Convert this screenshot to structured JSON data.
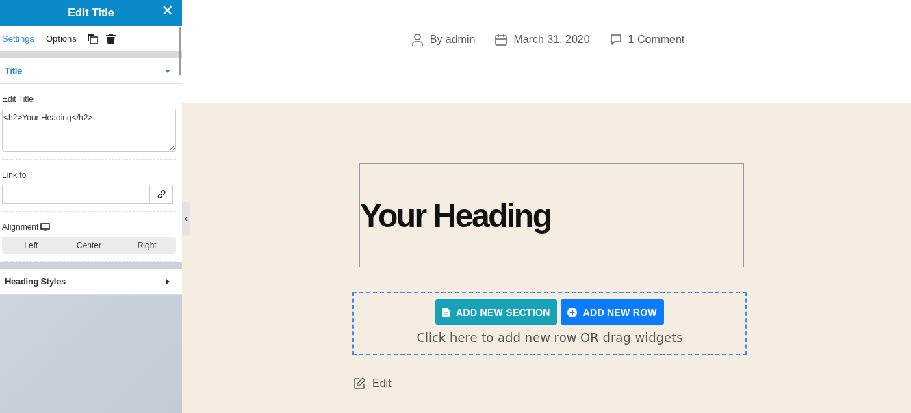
{
  "panel": {
    "title": "Edit Title",
    "close": "✕",
    "tabs": [
      {
        "label": "Settings",
        "selected": true
      },
      {
        "label": "Options",
        "selected": false
      }
    ],
    "sections": [
      {
        "title": "Title",
        "expanded": true
      },
      {
        "title": "Heading Styles",
        "expanded": false
      }
    ],
    "edit_title": {
      "label": "Edit Title",
      "value": "<h2>Your Heading</h2>"
    },
    "link_to": {
      "label": "Link to"
    },
    "alignment": {
      "label": "Alignment",
      "options": [
        {
          "label": "Left",
          "selected": false
        },
        {
          "label": "Center",
          "selected": false
        },
        {
          "label": "Right",
          "selected": false
        }
      ]
    },
    "collapse": "‹"
  },
  "meta": [
    {
      "kind": "author",
      "text": "By admin"
    },
    {
      "kind": "date",
      "text": "March 31, 2020"
    },
    {
      "kind": "comments",
      "text": "1 Comment"
    }
  ],
  "heading": "Your Heading",
  "add_area": {
    "buttons": [
      {
        "kind": "section",
        "label": "ADD NEW SECTION"
      },
      {
        "kind": "row",
        "label": "ADD NEW ROW"
      }
    ],
    "hint": "Click here to add new row OR drag widgets"
  },
  "edit_link": "Edit"
}
